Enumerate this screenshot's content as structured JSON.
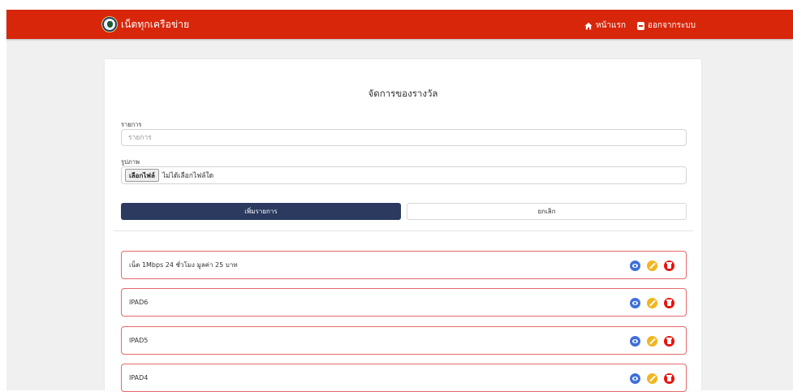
{
  "navbar": {
    "brand": "เน็ตทุกเครือข่าย",
    "home_label": "หน้าแรก",
    "logout_label": "ออกจากระบบ",
    "bg_color": "#d8260b"
  },
  "form": {
    "title": "จัดการของรางวัล",
    "item_label": "รายการ",
    "item_placeholder": "รายการ",
    "item_value": "",
    "image_label": "รูปภาพ",
    "file_button": "เลือกไฟล์",
    "file_status": "ไม่ได้เลือกไฟล์ใด",
    "submit_label": "เพิ่มรายการ",
    "cancel_label": "ยกเลิก"
  },
  "items": [
    {
      "name": "เน็ต 1Mbps 24 ชั่วโมง มูลค่า 25 บาท"
    },
    {
      "name": "IPAD6"
    },
    {
      "name": "IPAD5"
    },
    {
      "name": "IPAD4"
    }
  ],
  "icons": {
    "view": "eye-icon",
    "edit": "pencil-icon",
    "delete": "trash-icon",
    "view_color": "#3f6fd8",
    "edit_color": "#f2b51d",
    "delete_color": "#e8130c"
  }
}
